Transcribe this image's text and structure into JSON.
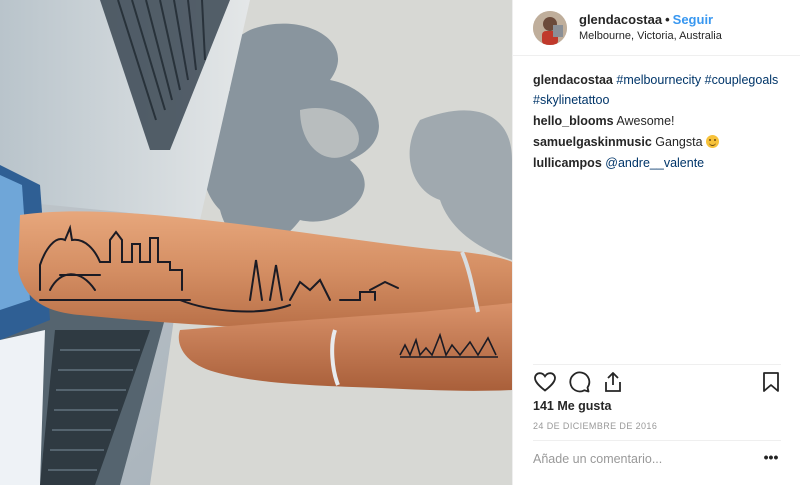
{
  "post": {
    "username": "glendacostaa",
    "separator": "•",
    "follow_label": "Seguir",
    "location": "Melbourne, Victoria, Australia",
    "caption_user": "glendacostaa",
    "caption_tags": [
      "#melbournecity",
      "#couplegoals",
      "#skylinetattoo"
    ],
    "likes": "141 Me gusta",
    "date": "24 DE DICIEMBRE DE 2016",
    "add_comment_placeholder": "Añade un comentario...",
    "more_label": "•••"
  },
  "comments": [
    {
      "user": "hello_blooms",
      "text": "Awesome!"
    },
    {
      "user": "samuelgaskinmusic",
      "text": "Gangsta",
      "emoji": "grinning-face"
    },
    {
      "user": "lullicampos",
      "mention": "@andre__valente"
    }
  ],
  "icons": [
    "heart-icon",
    "comment-icon",
    "share-icon",
    "bookmark-icon"
  ],
  "colors": {
    "follow": "#3897f0",
    "link": "#003569",
    "muted": "#999999",
    "text": "#262626"
  }
}
